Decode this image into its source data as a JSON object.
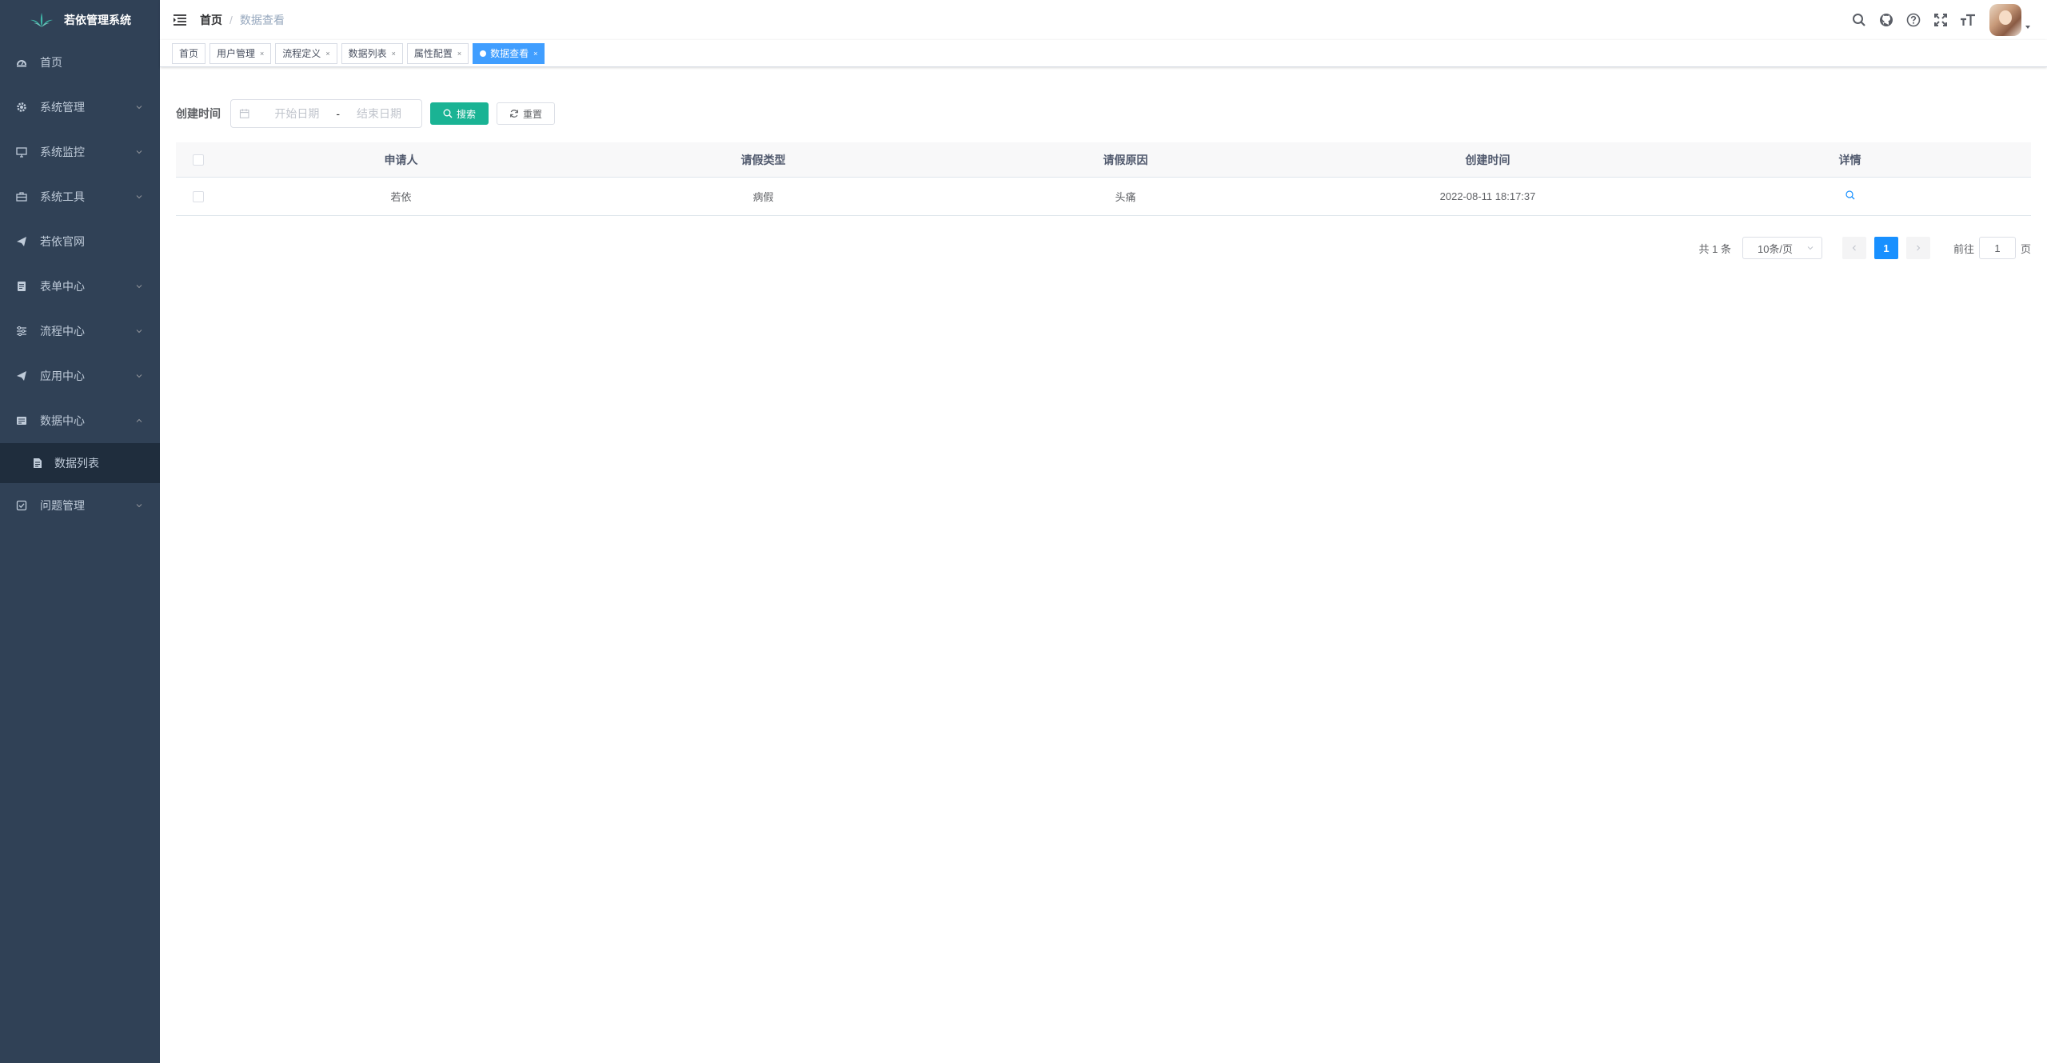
{
  "app": {
    "title": "若依管理系统"
  },
  "sidebar": {
    "items": [
      {
        "label": "首页",
        "icon": "dashboard-icon"
      },
      {
        "label": "系统管理",
        "icon": "gear-icon"
      },
      {
        "label": "系统监控",
        "icon": "monitor-icon"
      },
      {
        "label": "系统工具",
        "icon": "toolbox-icon"
      },
      {
        "label": "若依官网",
        "icon": "send-icon"
      },
      {
        "label": "表单中心",
        "icon": "form-icon"
      },
      {
        "label": "流程中心",
        "icon": "flow-icon"
      },
      {
        "label": "应用中心",
        "icon": "send-icon"
      },
      {
        "label": "数据中心",
        "icon": "data-icon"
      },
      {
        "label": "问题管理",
        "icon": "checkbox-icon"
      }
    ],
    "sub_items": [
      {
        "label": "数据列表",
        "icon": "document-icon"
      }
    ]
  },
  "breadcrumb": {
    "home": "首页",
    "separator": "/",
    "current": "数据查看"
  },
  "tags": [
    {
      "label": "首页"
    },
    {
      "label": "用户管理"
    },
    {
      "label": "流程定义"
    },
    {
      "label": "数据列表"
    },
    {
      "label": "属性配置"
    },
    {
      "label": "数据查看"
    }
  ],
  "search": {
    "label": "创建时间",
    "start_placeholder": "开始日期",
    "end_placeholder": "结束日期",
    "range_separator": "-",
    "search_button": "搜索",
    "reset_button": "重置"
  },
  "table": {
    "columns": [
      "申请人",
      "请假类型",
      "请假原因",
      "创建时间",
      "详情"
    ],
    "rows": [
      {
        "applicant": "若依",
        "leave_type": "病假",
        "reason": "头痛",
        "created_at": "2022-08-11 18:17:37"
      }
    ]
  },
  "pagination": {
    "total_text": "共 1 条",
    "page_size": "10条/页",
    "current_page": "1",
    "goto_label": "前往",
    "goto_value": "1",
    "page_unit": "页"
  },
  "colors": {
    "sidebar_bg": "#304156",
    "submenu_bg": "#1f2d3d",
    "active_tag": "#409eff",
    "primary_button": "#1ab394",
    "page_active": "#1890ff"
  }
}
